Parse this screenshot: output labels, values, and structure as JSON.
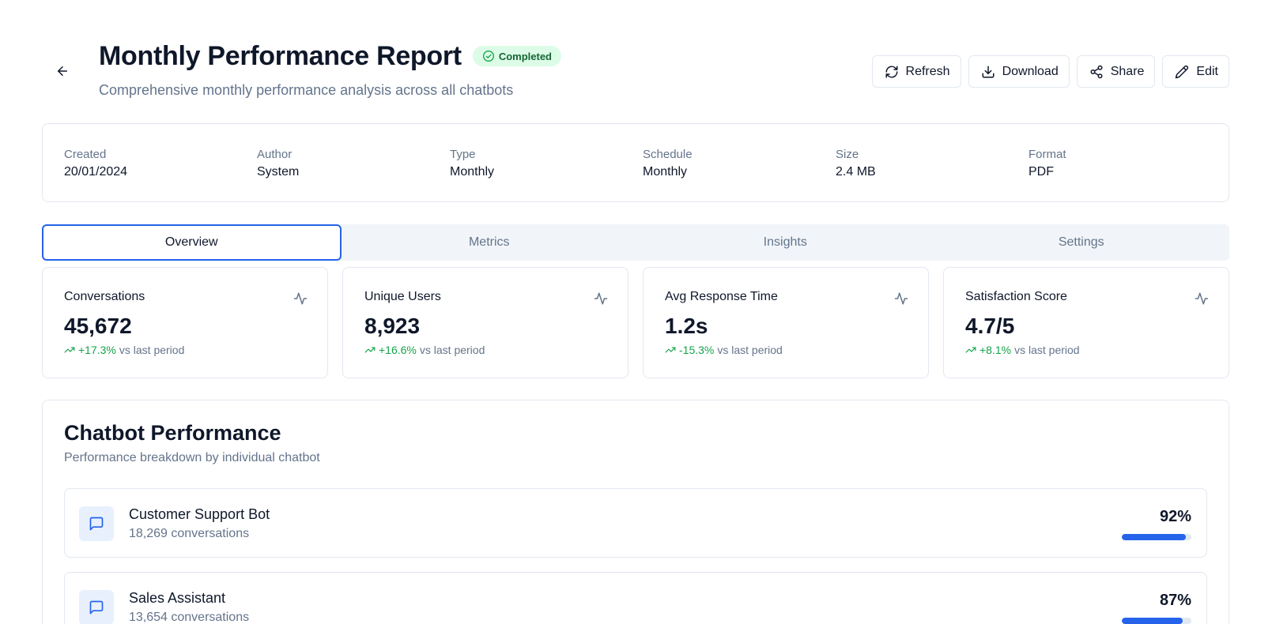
{
  "header": {
    "title": "Monthly Performance Report",
    "status": "Completed",
    "subtitle": "Comprehensive monthly performance analysis across all chatbots",
    "back_icon": "arrow-left-icon"
  },
  "actions": [
    {
      "label": "Refresh",
      "icon": "refresh-icon"
    },
    {
      "label": "Download",
      "icon": "download-icon"
    },
    {
      "label": "Share",
      "icon": "share-icon"
    },
    {
      "label": "Edit",
      "icon": "pencil-icon"
    }
  ],
  "meta": [
    {
      "label": "Created",
      "value": "20/01/2024"
    },
    {
      "label": "Author",
      "value": "System"
    },
    {
      "label": "Type",
      "value": "Monthly"
    },
    {
      "label": "Schedule",
      "value": "Monthly"
    },
    {
      "label": "Size",
      "value": "2.4 MB"
    },
    {
      "label": "Format",
      "value": "PDF"
    }
  ],
  "tabs": [
    {
      "label": "Overview",
      "active": true
    },
    {
      "label": "Metrics",
      "active": false
    },
    {
      "label": "Insights",
      "active": false
    },
    {
      "label": "Settings",
      "active": false
    }
  ],
  "stats": [
    {
      "label": "Conversations",
      "value": "45,672",
      "change": "+17.3%",
      "suffix": "vs last period"
    },
    {
      "label": "Unique Users",
      "value": "8,923",
      "change": "+16.6%",
      "suffix": "vs last period"
    },
    {
      "label": "Avg Response Time",
      "value": "1.2s",
      "change": "-15.3%",
      "suffix": "vs last period"
    },
    {
      "label": "Satisfaction Score",
      "value": "4.7/5",
      "change": "+8.1%",
      "suffix": "vs last period"
    }
  ],
  "performance": {
    "title": "Chatbot Performance",
    "subtitle": "Performance breakdown by individual chatbot",
    "bots": [
      {
        "name": "Customer Support Bot",
        "conversations": "18,269 conversations",
        "score": "92%",
        "progress": 0.92
      },
      {
        "name": "Sales Assistant",
        "conversations": "13,654 conversations",
        "score": "87%",
        "progress": 0.87
      }
    ]
  },
  "colors": {
    "accent": "#2563eb",
    "positive": "#16a34a",
    "badge_bg": "#dcfce7",
    "badge_text": "#166534",
    "muted": "#64748b",
    "border": "#e2e8f0"
  }
}
